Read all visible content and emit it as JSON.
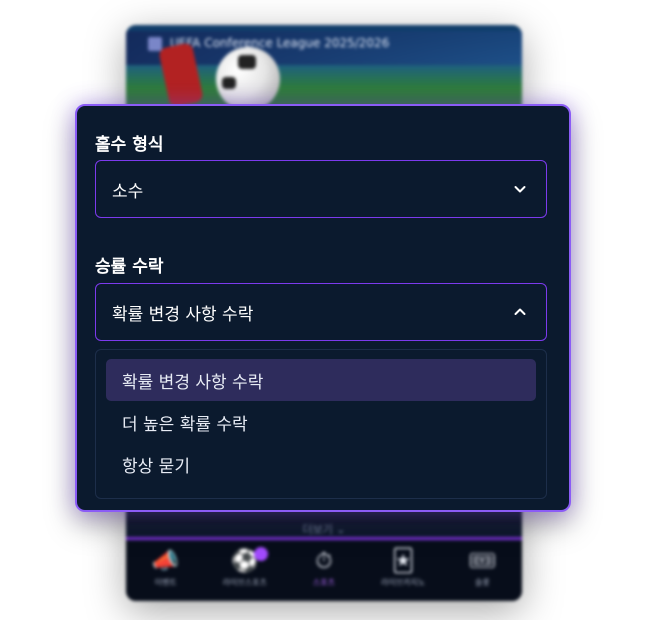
{
  "background_app": {
    "hero_title": "UEFA Conference League 2025/2026",
    "more_label": "더보기 ⌄",
    "tabs": [
      {
        "icon": "megaphone-icon",
        "glyph": "📣",
        "label": "이벤트"
      },
      {
        "icon": "soccer-ball-icon",
        "glyph": "⚽",
        "label": "라이브스포츠"
      },
      {
        "icon": "stopwatch-icon",
        "glyph": "⏱",
        "label": "스포츠"
      },
      {
        "icon": "cards-icon",
        "glyph": "🃏",
        "label": "라이브카지노"
      },
      {
        "icon": "ticket-icon",
        "glyph": "🎟",
        "label": "슬롯"
      }
    ],
    "active_tab_index": 2,
    "accent_color": "#8b5cf6"
  },
  "odds_format": {
    "label": "홀수 형식",
    "selected": "소수"
  },
  "odds_acceptance": {
    "label": "승률 수락",
    "selected": "확률 변경 사항 수락",
    "expanded": true,
    "options": [
      {
        "label": "확률 변경 사항 수락",
        "selected": true
      },
      {
        "label": "더 높은 확률 수락",
        "selected": false
      },
      {
        "label": "항상 묻기",
        "selected": false
      }
    ]
  }
}
